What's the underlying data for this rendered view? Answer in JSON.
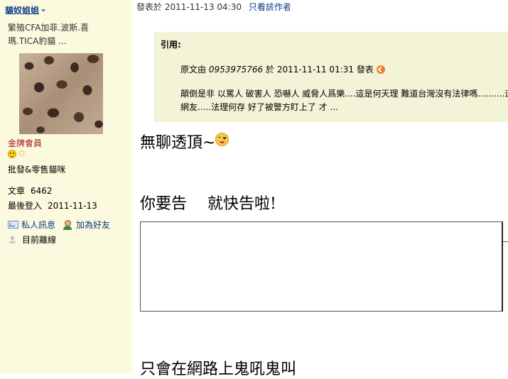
{
  "author": {
    "name": "貓奴姐姐",
    "custom_title": "繁殖CFA加菲.波斯.喜瑪.TICA豹貓 ...",
    "rank": "金牌會員",
    "tag": "批發&零售貓咪",
    "stats": {
      "posts_label": "文章",
      "posts_value": "6462",
      "last_login_label": "最後登入",
      "last_login_value": "2011-11-13"
    },
    "actions": {
      "pm_label": "私人訊息",
      "add_friend_label": "加為好友",
      "status_label": "目前離線"
    }
  },
  "post": {
    "posted_prefix": "發表於",
    "posted_time": "2011-11-13 04:30",
    "author_only_label": "只看該作者",
    "quote": {
      "header": "引用:",
      "origin_prefix": "原文由",
      "origin_user": "0953975766",
      "origin_on": "於",
      "origin_time": "2011-11-11 01:31",
      "origin_suffix": "發表",
      "body_line1": "顛倒是非 以罵人 破害人 恐嚇人 威脅人爲樂....這是何天理 難道台灣沒有法律嗎..........這不",
      "body_line2": "網友.....法理何存 好了被警方盯上了 才 ..."
    },
    "content": {
      "line1": "無聊透頂~",
      "line2": "你要告　 就快告啦!",
      "line3": "只會在網路上鬼吼鬼叫"
    }
  },
  "colors": {
    "sidebar_bg": "#fbf9de",
    "link": "#0b3a86",
    "rank": "#a61010",
    "quote_bg": "#f3f3d7"
  },
  "icons": {
    "author_menu": "chevron-down-icon",
    "rank": [
      "smile-icon",
      "star-icon"
    ],
    "pm": "message-icon",
    "add_friend": "add-friend-icon",
    "status": "offline-user-icon",
    "quote_goto": "goto-post-icon",
    "emoticon": "grin-emoticon-icon"
  }
}
